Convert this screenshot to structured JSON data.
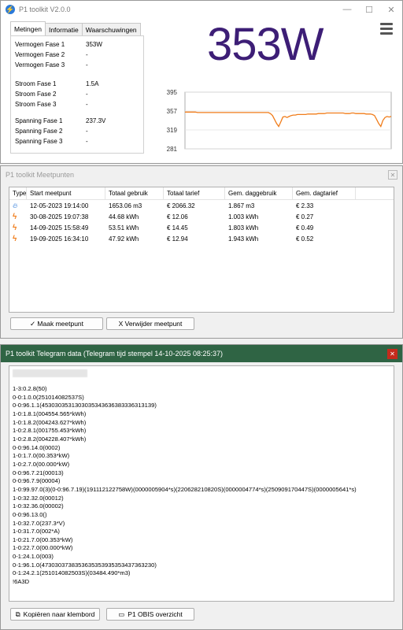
{
  "main_window": {
    "title": "P1 toolkit V2.0.0",
    "icon": "lightning-icon",
    "tabs": [
      "Metingen",
      "Informatie",
      "Waarschuwingen"
    ],
    "active_tab": "Metingen",
    "readings": [
      {
        "label": "Vermogen Fase 1",
        "value": "353W"
      },
      {
        "label": "Vermogen Fase 2",
        "value": "-"
      },
      {
        "label": "Vermogen Fase 3",
        "value": "-"
      },
      {
        "label": "Stroom Fase 1",
        "value": "1.5A"
      },
      {
        "label": "Stroom Fase 2",
        "value": "-"
      },
      {
        "label": "Stroom Fase 3",
        "value": "-"
      },
      {
        "label": "Spanning Fase 1",
        "value": "237.3V"
      },
      {
        "label": "Spanning Fase 2",
        "value": "-"
      },
      {
        "label": "Spanning Fase 3",
        "value": "-"
      }
    ],
    "big_power": "353W",
    "menu_icon": "hamburger-icon"
  },
  "chart_data": {
    "type": "line",
    "ylim": [
      281,
      395
    ],
    "yticks": [
      "395",
      "357",
      "319",
      "281"
    ],
    "grid": true,
    "color": "#f07c1a",
    "values": [
      355,
      355,
      355,
      355,
      355,
      355,
      354,
      354,
      354,
      354,
      354,
      354,
      354,
      354,
      354,
      354,
      354,
      354,
      354,
      354,
      354,
      354,
      354,
      354,
      354,
      354,
      354,
      354,
      354,
      354,
      354,
      354,
      354,
      354,
      354,
      354,
      354,
      354,
      354,
      354,
      354,
      352,
      348,
      340,
      332,
      326,
      335,
      345,
      346,
      344,
      346,
      348,
      349,
      349,
      350,
      350,
      350,
      350,
      350,
      351,
      351,
      351,
      351,
      351,
      352,
      352,
      352,
      352,
      353,
      353,
      353,
      353,
      353,
      353,
      353,
      353,
      353,
      352,
      352,
      352,
      353,
      353,
      352,
      352,
      352,
      352,
      352,
      351,
      351,
      351,
      350,
      348,
      340,
      332,
      326,
      338,
      344,
      346,
      345,
      346
    ]
  },
  "measure_window": {
    "title": "P1 toolkit Meetpunten",
    "columns": [
      "Type",
      "Start meetpunt",
      "Totaal gebruik",
      "Totaal tarief",
      "Gem. daggebruik",
      "Gem. dagtarief"
    ],
    "rows": [
      {
        "icon": "gas-flame-icon",
        "start": "12-05-2023 19:14:00",
        "total": "1653.06 m3",
        "tariff": "€ 2066.32",
        "daily": "1.867 m3",
        "daytariff": "€ 2.33"
      },
      {
        "icon": "lightning-icon",
        "start": "30-08-2025 19:07:38",
        "total": "44.68 kWh",
        "tariff": "€ 12.06",
        "daily": "1.003 kWh",
        "daytariff": "€ 0.27"
      },
      {
        "icon": "lightning-icon",
        "start": "14-09-2025 15:58:49",
        "total": "53.51 kWh",
        "tariff": "€ 14.45",
        "daily": "1.803 kWh",
        "daytariff": "€ 0.49"
      },
      {
        "icon": "lightning-icon",
        "start": "19-09-2025 16:34:10",
        "total": "47.92 kWh",
        "tariff": "€ 12.94",
        "daily": "1.943 kWh",
        "daytariff": "€ 0.52"
      }
    ],
    "make_button": "✓ Maak meetpunt",
    "remove_button": "X Verwijder meetpunt"
  },
  "telegram_window": {
    "title": "P1 toolkit Telegram data (Telegram tijd stempel 14-10-2025 08:25:37)",
    "lines": [
      "1-3:0.2.8(50)",
      "0-0:1.0.0(251014082537S)",
      "0-0:96.1.1(4530303531303035343636383336313139)",
      "1-0:1.8.1(004554.565*kWh)",
      "1-0:1.8.2(004243.627*kWh)",
      "1-0:2.8.1(001755.453*kWh)",
      "1-0:2.8.2(004228.407*kWh)",
      "0-0:96.14.0(0002)",
      "1-0:1.7.0(00.353*kW)",
      "1-0:2.7.0(00.000*kW)",
      "0-0:96.7.21(00013)",
      "0-0:96.7.9(00004)",
      "1-0:99.97.0(3)(0-0:96.7.19)(191112122758W)(0000005904*s)(220628210820S)(0000004774*s)(250909170447S)(0000005641*s)",
      "1-0:32.32.0(00012)",
      "1-0:32.36.0(00002)",
      "0-0:96.13.0()",
      "1-0:32.7.0(237.3*V)",
      "1-0:31.7.0(002*A)",
      "1-0:21.7.0(00.353*kW)",
      "1-0:22.7.0(00.000*kW)",
      "0-1:24.1.0(003)",
      "0-1:96.1.0(4730303738353635353935353437363230)",
      "0-1:24.2.1(251014082503S)(03484.490*m3)",
      "!6A3D"
    ],
    "copy_button": "Kopiëren naar klembord",
    "obis_button": "P1 OBIS overzicht"
  }
}
